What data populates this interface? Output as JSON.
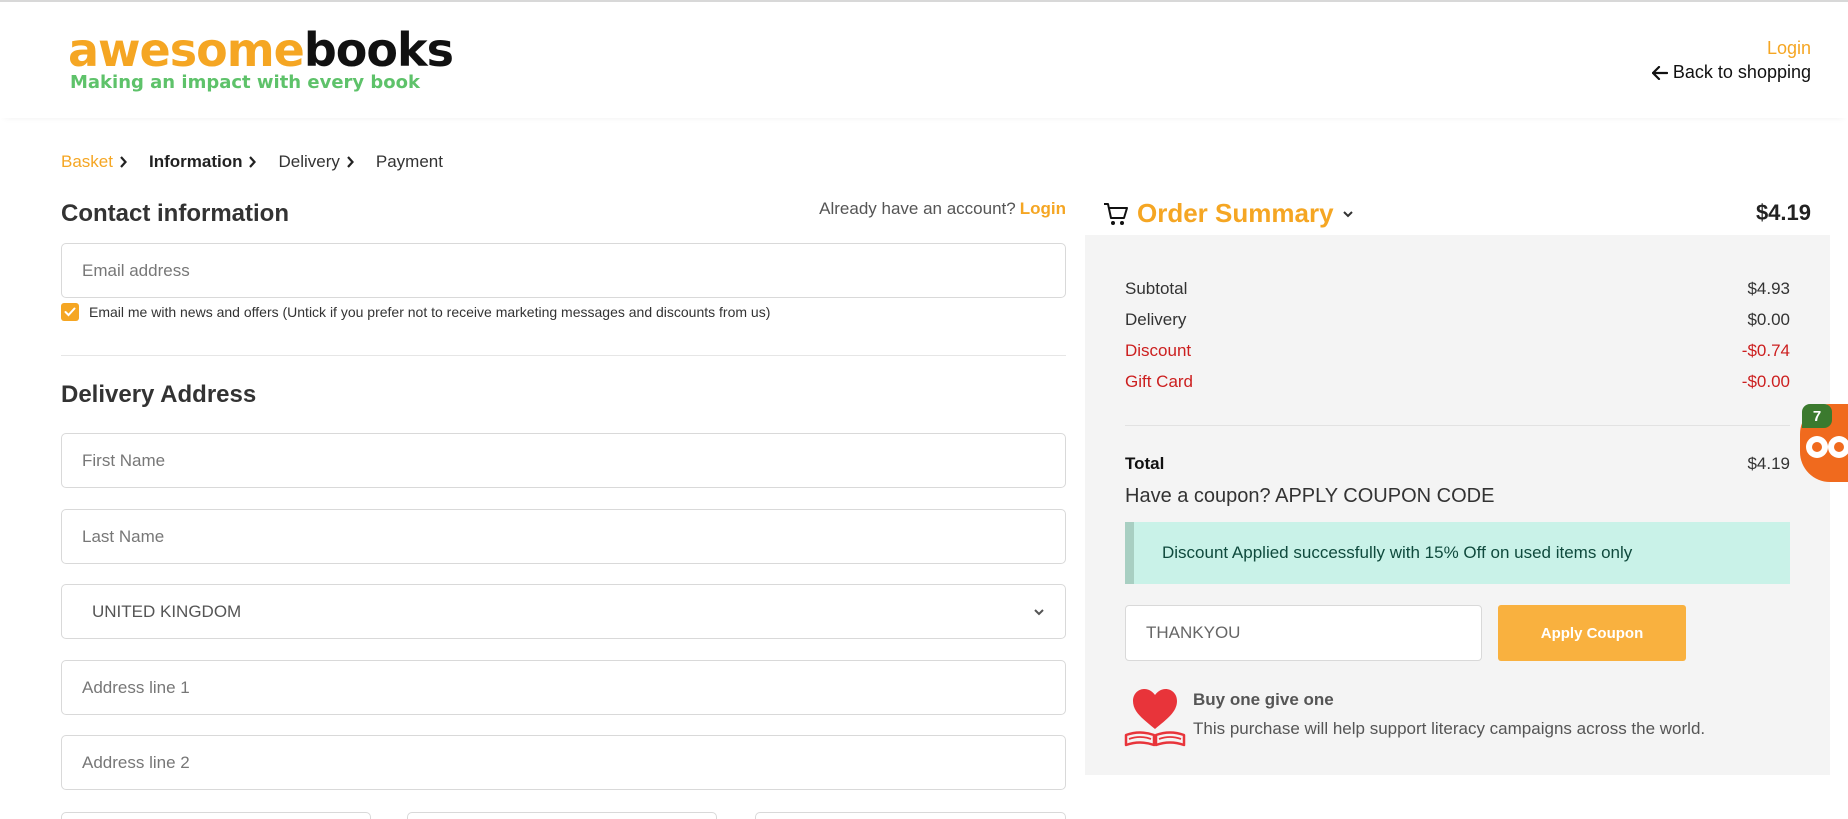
{
  "brand": {
    "logo_part1": "awesome",
    "logo_part2": "books",
    "tagline": "Making an impact with every book",
    "colors": {
      "accent": "#f5a623",
      "tagline": "#5ec26a",
      "dark": "#111111"
    }
  },
  "header": {
    "login": "Login",
    "back": "Back to shopping",
    "back_icon": "arrow-left-icon"
  },
  "breadcrumb": {
    "items": [
      "Basket",
      "Information",
      "Delivery",
      "Payment"
    ]
  },
  "contact": {
    "title": "Contact information",
    "account_prompt": "Already have an account?",
    "account_login": "Login",
    "email_placeholder": "Email address",
    "newsletter_label": "Email me with news and offers (Untick if you prefer not to receive marketing messages and discounts from us)",
    "newsletter_checked": true
  },
  "delivery": {
    "title": "Delivery Address",
    "first_name_placeholder": "First Name",
    "last_name_placeholder": "Last Name",
    "country_selected": "UNITED KINGDOM",
    "address1_placeholder": "Address line 1",
    "address2_placeholder": "Address line 2"
  },
  "summary": {
    "title": "Order Summary",
    "header_total": "$4.19",
    "rows": [
      {
        "label": "Subtotal",
        "value": "$4.93"
      },
      {
        "label": "Delivery",
        "value": "$0.00"
      },
      {
        "label": "Discount",
        "value": "-$0.74"
      },
      {
        "label": "Gift Card",
        "value": "-$0.00"
      }
    ],
    "total_label": "Total",
    "total_value": "$4.19",
    "coupon_prompt": "Have a coupon? APPLY COUPON CODE",
    "alert": "Discount Applied successfully with 15% Off on used items only",
    "coupon_value": "THANKYOU",
    "apply_button": "Apply Coupon",
    "bogo_title": "Buy one give one",
    "bogo_text": "This purchase will help support literacy campaigns across the world."
  },
  "badge": {
    "count": "7"
  }
}
